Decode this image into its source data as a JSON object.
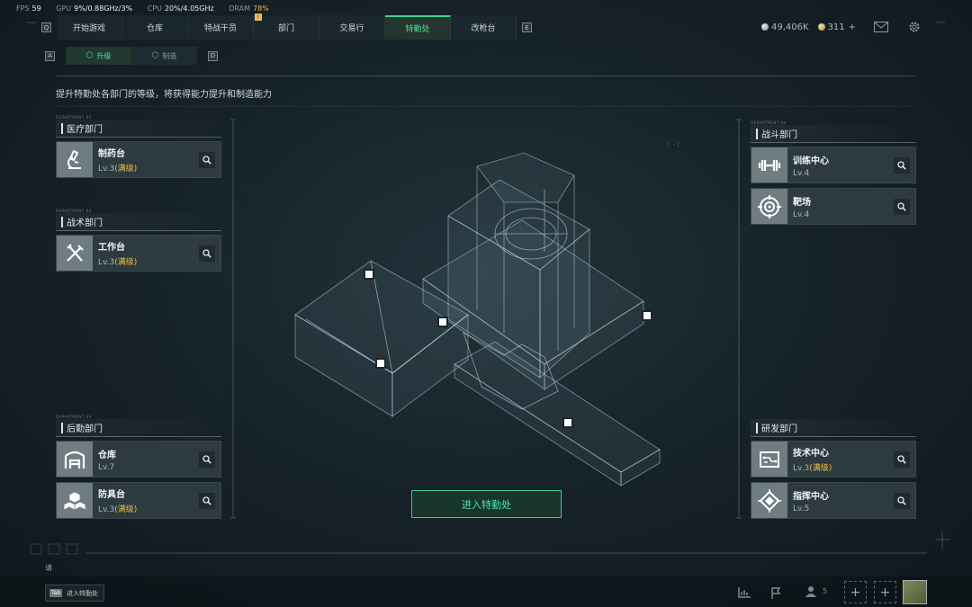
{
  "perf": {
    "fps_label": "FPS",
    "fps": "59",
    "gpu_label": "GPU",
    "gpu": "9%/0.88GHz/3%",
    "cpu_label": "CPU",
    "cpu": "20%/4.05GHz",
    "dram_label": "DRAM",
    "dram": "78%"
  },
  "nav": {
    "left_key": "Q",
    "right_key": "E",
    "tabs": [
      "开始游戏",
      "仓库",
      "特战干员",
      "部门",
      "交易行",
      "特勤处",
      "改枪台"
    ],
    "active": "特勤处",
    "alert": "!"
  },
  "currency": {
    "silver": "49,406K",
    "gold": "311",
    "add": "+"
  },
  "subnav": {
    "left_key": "A",
    "right_key": "D",
    "tabs": [
      "升级",
      "制造"
    ],
    "active": "升级"
  },
  "description": "提升特勤处各部门的等级，将获得能力提升和制造能力",
  "departments": {
    "medical": {
      "title": "医疗部门",
      "tag": "DEPARTMENT 01",
      "items": [
        {
          "name": "制药台",
          "level": "Lv.3",
          "max": "(满级)",
          "icon": "microscope-icon"
        }
      ]
    },
    "tactical": {
      "title": "战术部门",
      "tag": "DEPARTMENT 02",
      "items": [
        {
          "name": "工作台",
          "level": "Lv.3",
          "max": "(满级)",
          "icon": "tools-icon"
        }
      ]
    },
    "logistics": {
      "title": "后勤部门",
      "tag": "DEPARTMENT 03",
      "items": [
        {
          "name": "仓库",
          "level": "Lv.7",
          "max": "",
          "icon": "warehouse-icon"
        },
        {
          "name": "防具台",
          "level": "Lv.3",
          "max": "(满级)",
          "icon": "armor-crates-icon"
        }
      ]
    },
    "combat": {
      "title": "战斗部门",
      "tag": "DEPARTMENT 04",
      "items": [
        {
          "name": "训练中心",
          "level": "Lv.4",
          "max": "",
          "icon": "dumbbell-icon"
        },
        {
          "name": "靶场",
          "level": "Lv.4",
          "max": "",
          "icon": "target-icon"
        }
      ]
    },
    "research": {
      "title": "研发部门",
      "tag": "",
      "items": [
        {
          "name": "技术中心",
          "level": "Lv.3",
          "max": "(满级)",
          "icon": "circuit-icon"
        },
        {
          "name": "指挥中心",
          "level": "Lv.5",
          "max": "",
          "icon": "chip-icon"
        }
      ]
    }
  },
  "enter_button": "进入特勤处",
  "bottom": {
    "please": "请",
    "tab_key": "Tab",
    "tab_label": "进入特勤处",
    "friends_count": "5"
  },
  "colors": {
    "accent": "#3fd48f",
    "max_level": "#e9c14a",
    "background": "#17232a"
  }
}
